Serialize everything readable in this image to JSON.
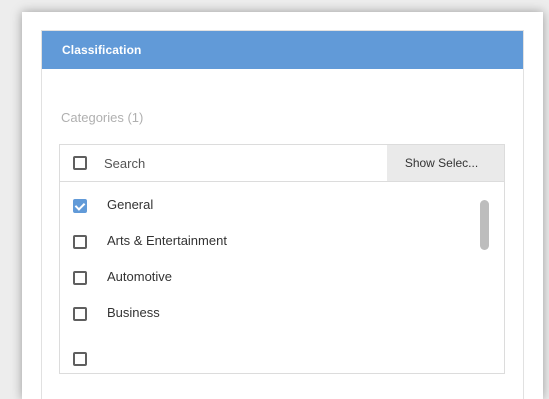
{
  "panel": {
    "title": "Classification"
  },
  "categories": {
    "label": "Categories (1)",
    "search": {
      "value": "",
      "placeholder": "Search"
    },
    "show_selected_label": "Show Selec...",
    "items": [
      {
        "label": "General",
        "checked": true
      },
      {
        "label": "Arts & Entertainment",
        "checked": false
      },
      {
        "label": "Automotive",
        "checked": false
      },
      {
        "label": "Business",
        "checked": false
      }
    ],
    "has_more_items": true
  },
  "colors": {
    "accent": "#619ad8",
    "header_text": "#ffffff",
    "muted_label": "#b0b0b0",
    "body_text": "#333333",
    "button_bg": "#eaeaea"
  },
  "icons": {
    "select_all": "checkbox-icon",
    "item_checked": "checked-checkbox-icon",
    "item_unchecked": "checkbox-icon"
  }
}
